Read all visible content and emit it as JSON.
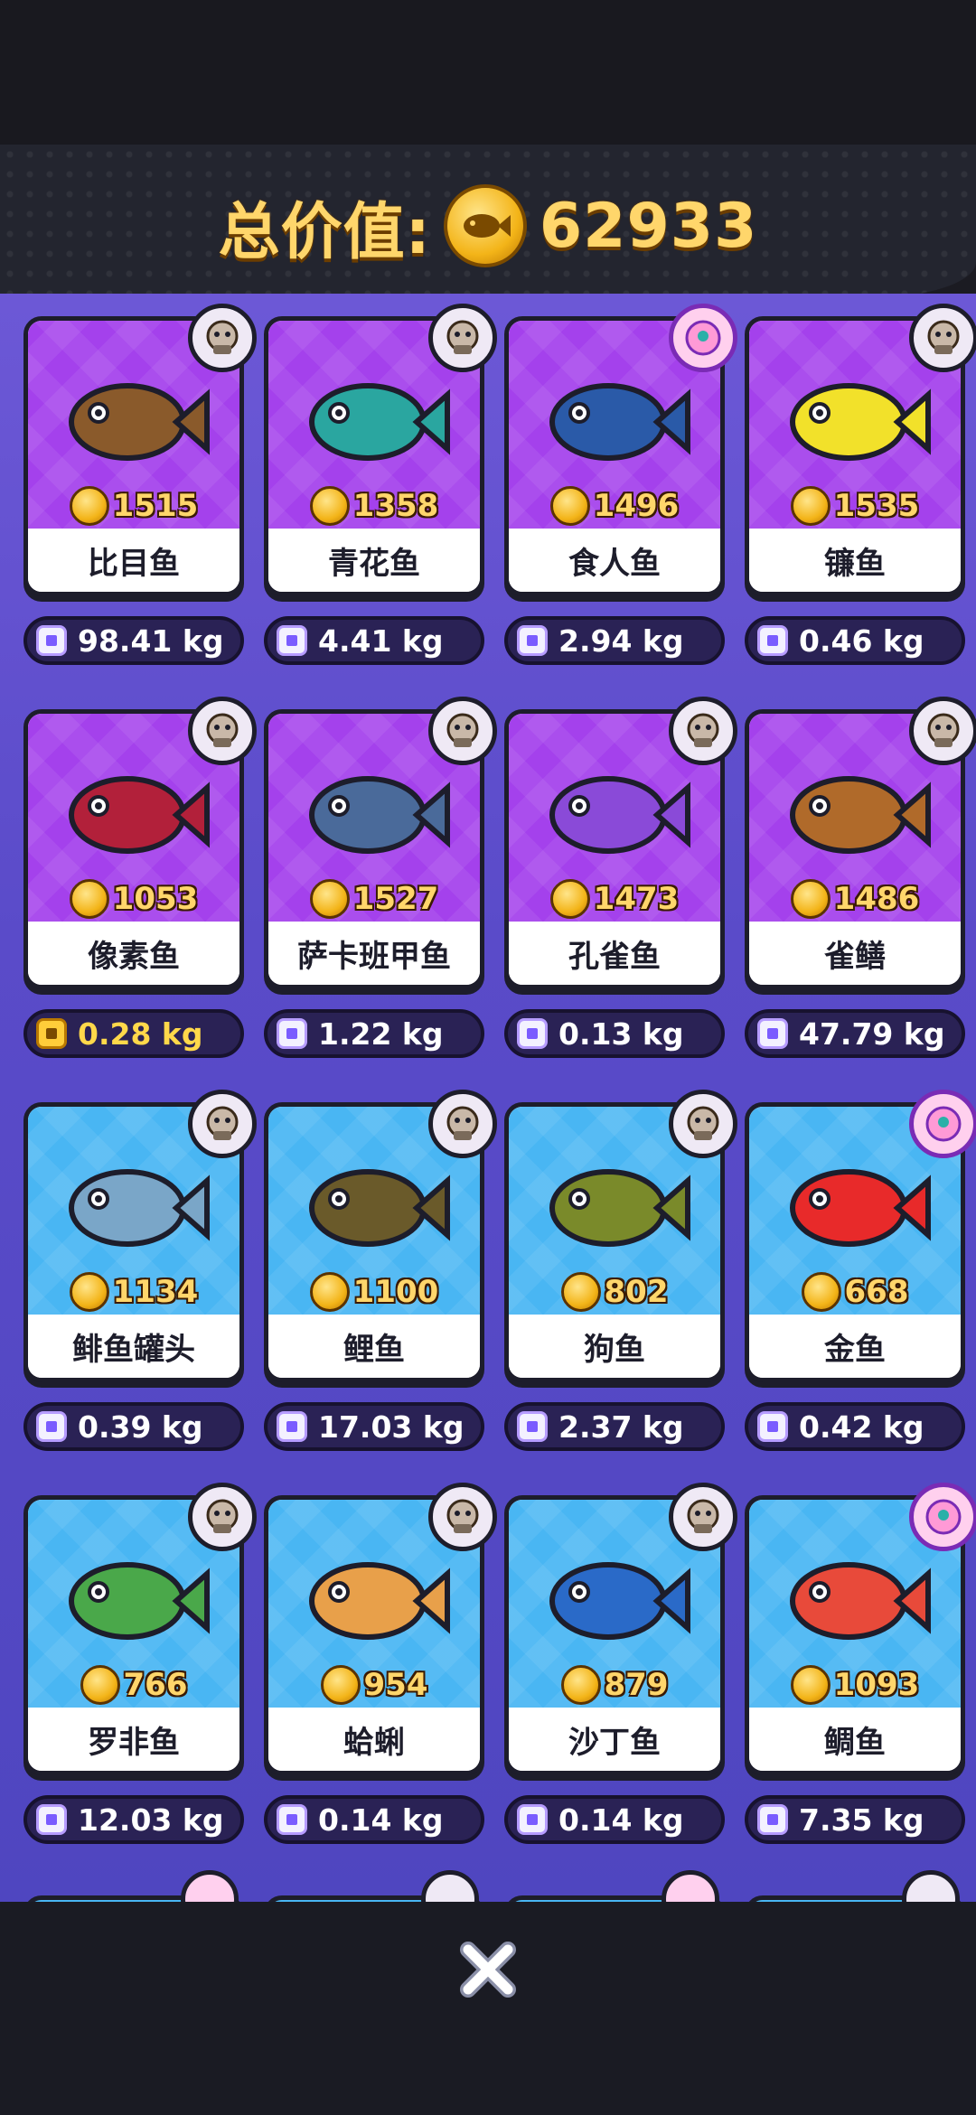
{
  "header": {
    "total_label": "总价值:",
    "total_value": "62933"
  },
  "colors": {
    "purple": "#a441ec",
    "blue": "#49b6f3",
    "gold": "#ffd66b"
  },
  "fish": [
    {
      "name": "比目鱼",
      "price": "1515",
      "weight": "98.41 kg",
      "tier": "purple",
      "badge": "monkey",
      "weight_style": "normal",
      "fish_icon": "flounder-icon",
      "color": "#8a5a2b"
    },
    {
      "name": "青花鱼",
      "price": "1358",
      "weight": "4.41 kg",
      "tier": "purple",
      "badge": "monkey",
      "weight_style": "normal",
      "fish_icon": "mackerel-icon",
      "color": "#2aa6a0"
    },
    {
      "name": "食人鱼",
      "price": "1496",
      "weight": "2.94 kg",
      "tier": "purple",
      "badge": "pink",
      "weight_style": "normal",
      "fish_icon": "piranha-icon",
      "color": "#2a5aa8"
    },
    {
      "name": "镰鱼",
      "price": "1535",
      "weight": "0.46 kg",
      "tier": "purple",
      "badge": "monkey",
      "weight_style": "normal",
      "fish_icon": "moorish-idol-icon",
      "color": "#f2e12a"
    },
    {
      "name": "像素鱼",
      "price": "1053",
      "weight": "0.28 kg",
      "tier": "purple",
      "badge": "monkey",
      "weight_style": "gold",
      "fish_icon": "pixel-fish-icon",
      "color": "#b2203a"
    },
    {
      "name": "萨卡班甲鱼",
      "price": "1527",
      "weight": "1.22 kg",
      "tier": "purple",
      "badge": "monkey",
      "weight_style": "normal",
      "fish_icon": "sacabambaspis-icon",
      "color": "#4a6a9a"
    },
    {
      "name": "孔雀鱼",
      "price": "1473",
      "weight": "0.13 kg",
      "tier": "purple",
      "badge": "monkey",
      "weight_style": "normal",
      "fish_icon": "guppy-icon",
      "color": "#8a4ad8"
    },
    {
      "name": "雀鳝",
      "price": "1486",
      "weight": "47.79 kg",
      "tier": "purple",
      "badge": "monkey",
      "weight_style": "normal",
      "fish_icon": "gar-icon",
      "color": "#b06a2a"
    },
    {
      "name": "鲱鱼罐头",
      "price": "1134",
      "weight": "0.39 kg",
      "tier": "blue",
      "badge": "monkey",
      "weight_style": "normal",
      "fish_icon": "herring-can-icon",
      "color": "#7aa6c8"
    },
    {
      "name": "鲤鱼",
      "price": "1100",
      "weight": "17.03 kg",
      "tier": "blue",
      "badge": "monkey",
      "weight_style": "normal",
      "fish_icon": "carp-icon",
      "color": "#6a5a2a"
    },
    {
      "name": "狗鱼",
      "price": "802",
      "weight": "2.37 kg",
      "tier": "blue",
      "badge": "monkey",
      "weight_style": "normal",
      "fish_icon": "pike-icon",
      "color": "#7a8a2a"
    },
    {
      "name": "金鱼",
      "price": "668",
      "weight": "0.42 kg",
      "tier": "blue",
      "badge": "pink",
      "weight_style": "normal",
      "fish_icon": "goldfish-icon",
      "color": "#e82a2a"
    },
    {
      "name": "罗非鱼",
      "price": "766",
      "weight": "12.03 kg",
      "tier": "blue",
      "badge": "monkey",
      "weight_style": "normal",
      "fish_icon": "tilapia-icon",
      "color": "#4aa84a"
    },
    {
      "name": "蛤蜊",
      "price": "954",
      "weight": "0.14 kg",
      "tier": "blue",
      "badge": "monkey",
      "weight_style": "normal",
      "fish_icon": "clam-icon",
      "color": "#e8a04a"
    },
    {
      "name": "沙丁鱼",
      "price": "879",
      "weight": "0.14 kg",
      "tier": "blue",
      "badge": "monkey",
      "weight_style": "normal",
      "fish_icon": "sardine-icon",
      "color": "#2a6ac8"
    },
    {
      "name": "鲷鱼",
      "price": "1093",
      "weight": "7.35 kg",
      "tier": "blue",
      "badge": "pink",
      "weight_style": "normal",
      "fish_icon": "snapper-icon",
      "color": "#e84a3a"
    }
  ]
}
